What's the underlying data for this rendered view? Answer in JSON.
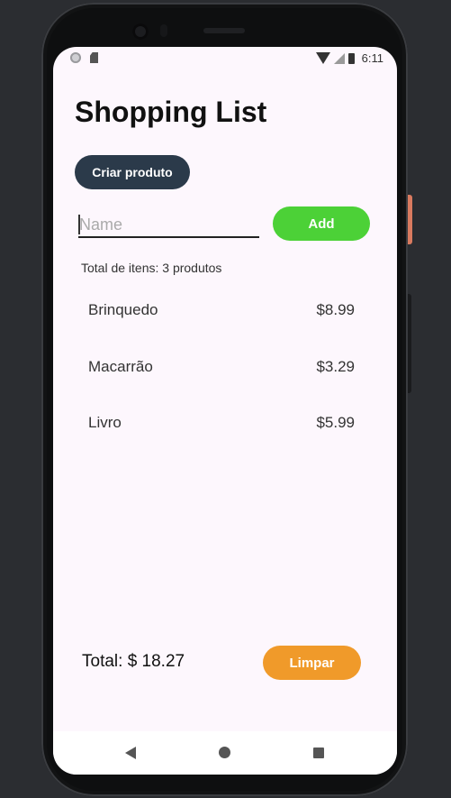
{
  "status_bar": {
    "time": "6:11"
  },
  "app": {
    "title": "Shopping List",
    "create_button": "Criar produto",
    "name_input": {
      "value": "",
      "placeholder": "Name"
    },
    "add_button": "Add",
    "items_count_text": "Total de itens: 3 produtos",
    "items": [
      {
        "name": "Brinquedo",
        "price": "$8.99"
      },
      {
        "name": "Macarrão",
        "price": "$3.29"
      },
      {
        "name": "Livro",
        "price": "$5.99"
      }
    ],
    "total_text": "Total: $ 18.27",
    "clear_button": "Limpar"
  },
  "colors": {
    "create_button": "#2b3a4a",
    "add_button": "#4cd137",
    "clear_button": "#f09a2a",
    "screen_bg": "#fdf7fd"
  }
}
